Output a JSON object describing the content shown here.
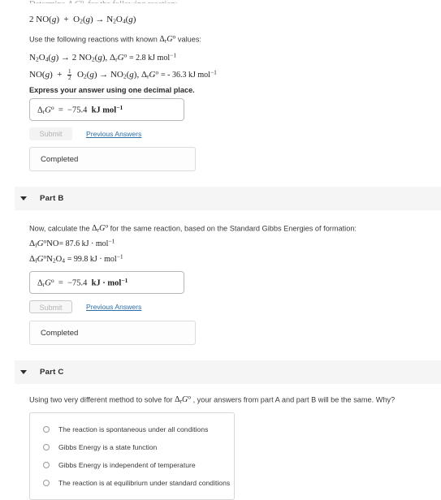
{
  "clipped_heading": "Determine ΔrG° for the following reaction:",
  "part_a": {
    "reaction_prefix": "2 NO",
    "instructions": "Use the following reactions with known",
    "instructions_suffix": "values:",
    "known_reaction_1_value": "= 2.8 kJ mol",
    "known_reaction_2_value": "= - 36.3 kJ mol",
    "precision_note": "Express your answer using one decimal place.",
    "answer_value": "−75.4",
    "answer_units": "kJ mol",
    "submit_label": "Submit",
    "previous_answers_label": "Previous Answers",
    "status_label": "Completed"
  },
  "part_b": {
    "title": "Part B",
    "prompt_prefix": "Now, calculate the",
    "prompt_suffix": "for the same reaction, based on the Standard Gibbs Energies of formation:",
    "formation_no_value": "= 87.6 kJ · mol",
    "formation_n2o4_value": "= 99.8 kJ · mol",
    "answer_value": "−75.4",
    "answer_units": "kJ · mol",
    "submit_label": "Submit",
    "previous_answers_label": "Previous Answers",
    "status_label": "Completed"
  },
  "part_c": {
    "title": "Part C",
    "question_prefix": "Using two very different method to solve for",
    "question_suffix": ", your answers from part A and part B will be the same. Why?",
    "options": [
      "The reaction is spontaneous under all conditions",
      "Gibbs Energy is a state function",
      "Gibbs Energy is independent of temperature",
      "The reaction is at equilibrium under standard conditions"
    ]
  },
  "colors": {
    "link": "#2b6ea8",
    "section_band": "#f5f5f5",
    "text": "#3a3a3a"
  }
}
